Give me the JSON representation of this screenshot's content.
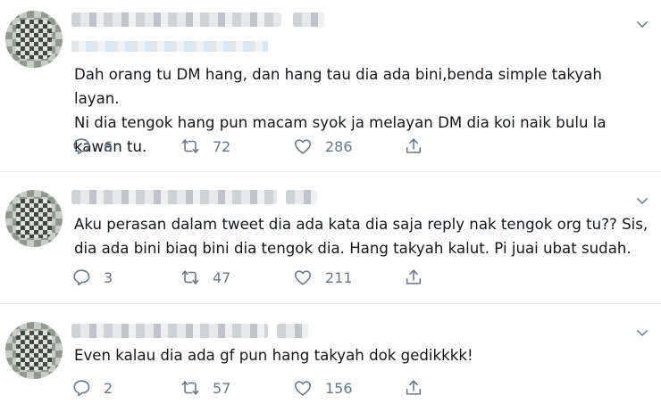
{
  "tweets": [
    {
      "text": "Dah orang tu DM hang, dan hang tau dia ada bini,benda simple takyah layan.\nNi dia tengok hang pun macam syok ja melayan DM dia koi naik bulu la\nkawan tu.",
      "reply_count": "6",
      "retweet_count": "72",
      "like_count": "286"
    },
    {
      "text": "Aku perasan dalam tweet dia ada kata dia saja reply nak tengok org tu?? Sis,\ndia ada bini biaq bini dia tengok dia. Hang takyah kalut. Pi juai ubat sudah.",
      "reply_count": "3",
      "retweet_count": "47",
      "like_count": "211"
    },
    {
      "text": "Even kalau dia ada gf pun hang takyah dok gedikkkk!",
      "reply_count": "2",
      "retweet_count": "57",
      "like_count": "156"
    }
  ],
  "icons": {
    "caret": "chevron-down-icon",
    "reply": "reply-icon",
    "retweet": "retweet-icon",
    "like": "like-icon",
    "share": "share-icon"
  },
  "colors": {
    "text": "#14171a",
    "secondary": "#657786",
    "divider": "#e6ecf0"
  }
}
